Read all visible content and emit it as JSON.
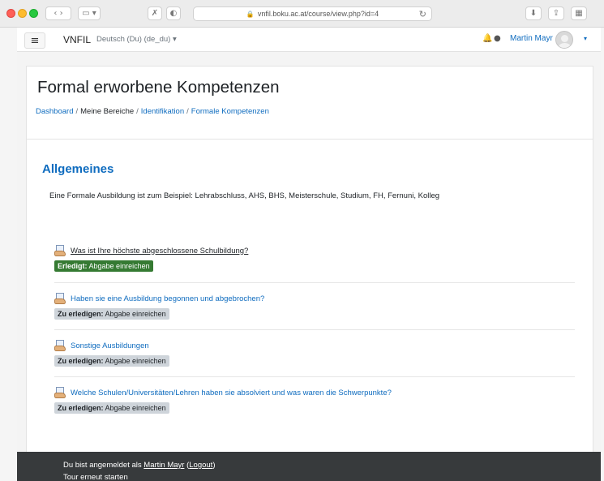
{
  "browser": {
    "url": "vnfil.boku.ac.at/course/view.php?id=4",
    "icons": [
      "sidebar-icon",
      "back-icon",
      "forward-icon",
      "tab-overview-icon",
      "extension-icon",
      "shield-icon",
      "reload-icon",
      "download-icon",
      "share-icon",
      "tabs-icon"
    ]
  },
  "navbar": {
    "menu_icon": "≡",
    "brand": "VNFIL",
    "language": "Deutsch (Du) (de_du) ▾",
    "user_name": "Martin Mayr",
    "caret": "▾"
  },
  "header": {
    "title": "Formal erworbene Kompetenzen",
    "breadcrumb": [
      {
        "label": "Dashboard",
        "link": true
      },
      {
        "label": "Meine Bereiche",
        "link": false
      },
      {
        "label": "Identifikation",
        "link": true
      },
      {
        "label": "Formale Kompetenzen",
        "link": true
      }
    ],
    "separator": "/"
  },
  "section": {
    "title": "Allgemeines",
    "summary": "Eine Formale Ausbildung ist zum Beispiel: Lehrabschluss, AHS, BHS, Meisterschule, Studium, FH, Fernuni, Kolleg"
  },
  "activities": [
    {
      "name": "Was ist Ihre höchste abgeschlossene Schulbildung?",
      "status_label": "Erledigt:",
      "status_text": "Abgabe einreichen",
      "state": "done"
    },
    {
      "name": "Haben sie eine Ausbildung begonnen und abgebrochen?",
      "status_label": "Zu erledigen:",
      "status_text": "Abgabe einreichen",
      "state": "todo"
    },
    {
      "name": "Sonstige Ausbildungen",
      "status_label": "Zu erledigen:",
      "status_text": "Abgabe einreichen",
      "state": "todo"
    },
    {
      "name": "Welche Schulen/Universitäten/Lehren haben sie absolviert und was waren die Schwerpunkte?",
      "status_label": "Zu erledigen:",
      "status_text": "Abgabe einreichen",
      "state": "todo"
    }
  ],
  "footer": {
    "logged_in_prefix": "Du bist angemeldet als",
    "user_link": "Martin Mayr",
    "logout_link": "Logout",
    "tour": "Tour erneut starten"
  },
  "colors": {
    "link": "#0f6cbf",
    "done_badge": "#357a32",
    "todo_badge": "#ced4da",
    "footer_bg": "#373a3c"
  }
}
